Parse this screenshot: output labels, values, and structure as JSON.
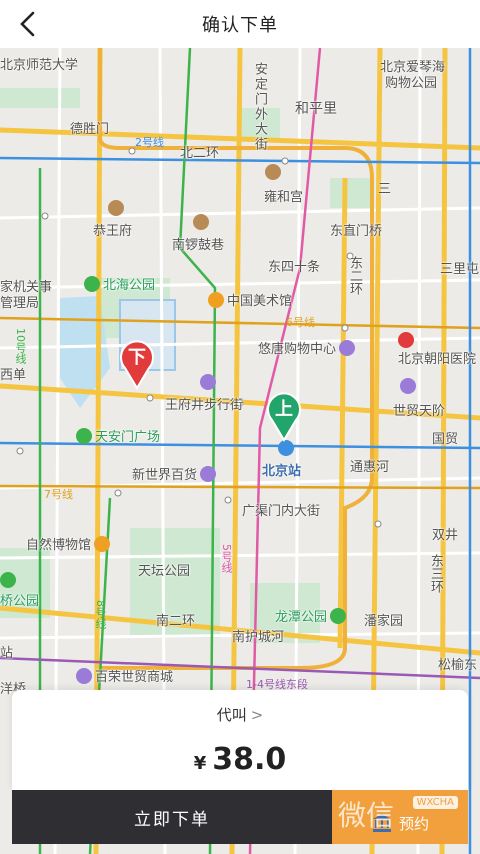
{
  "header": {
    "title": "确认下单"
  },
  "map": {
    "labels": {
      "bnu": "北京师范大学",
      "aiqinhai": "北京爱琴海",
      "aiqinhai2": "购物公园",
      "andingmen": "安定门外大街",
      "hepingli": "和平里",
      "deshengmen": "德胜门",
      "line2": "2号线",
      "bei2huan": "北二环",
      "yonghegong": "雍和宫",
      "gongwangfu": "恭王府",
      "nanluoguxiang": "南锣鼓巷",
      "dongzhimenqiao": "东直门桥",
      "beihai": "北海公园",
      "dongsishitiao": "东四十条",
      "dong2huan": "东二环",
      "sanliitun": "三里屯",
      "meishuguan": "中国美术馆",
      "line6": "6号线",
      "youtai": "悠唐购物中心",
      "chaoyang_hosp": "北京朝阳医院",
      "wangfujing": "王府井步行街",
      "shimao": "世贸天阶",
      "tiananmen": "天安门广场",
      "beijingzhan": "北京站",
      "tonghuihe": "通惠河",
      "guomao": "国贸",
      "xinshijie": "新世界百货",
      "line7": "7号线",
      "guangqumen": "广渠门内大街",
      "shuangjing": "双井",
      "ziranbowuguan": "自然博物馆",
      "tiantan": "天坛公园",
      "longtan": "龙潭公园",
      "nan2huan": "南二环",
      "nanhuchenghe": "南护城河",
      "panjiayuan": "潘家园",
      "dong3huan": "东三环",
      "songyuqiao": "松榆东",
      "bairong": "百荣世贸商城",
      "line14": "1-4号线东段",
      "line5": "5号线",
      "line8": "8号线",
      "xidan": "西单",
      "qiaoyuan": "桥公园",
      "jiguan": "家机关事",
      "guanliju": "管理局",
      "line10": "10号线",
      "zhuangqiao": "洋桥",
      "zhan": "站",
      "san": "三"
    },
    "markers": {
      "dropoff_glyph": "下",
      "pickup_glyph": "上"
    }
  },
  "order": {
    "call_type": "代叫",
    "chevron": ">",
    "currency": "¥",
    "price": "38.0"
  },
  "actions": {
    "submit": "立即下单",
    "reserve": "预约",
    "watermark": "微信",
    "watermark_badge": "WXCHA"
  },
  "colors": {
    "ring_road": "#f5c542",
    "subway_green": "#3cb44b",
    "subway_pink": "#e05aa6",
    "subway_purple": "#9b59b6",
    "subway_blue": "#3d8fe0",
    "subway_orange": "#e0a21c",
    "submit_bg": "#2f2f33",
    "reserve_bg": "#f2a03d",
    "pickup_marker": "#21a56a",
    "dropoff_marker": "#e23b3b"
  }
}
